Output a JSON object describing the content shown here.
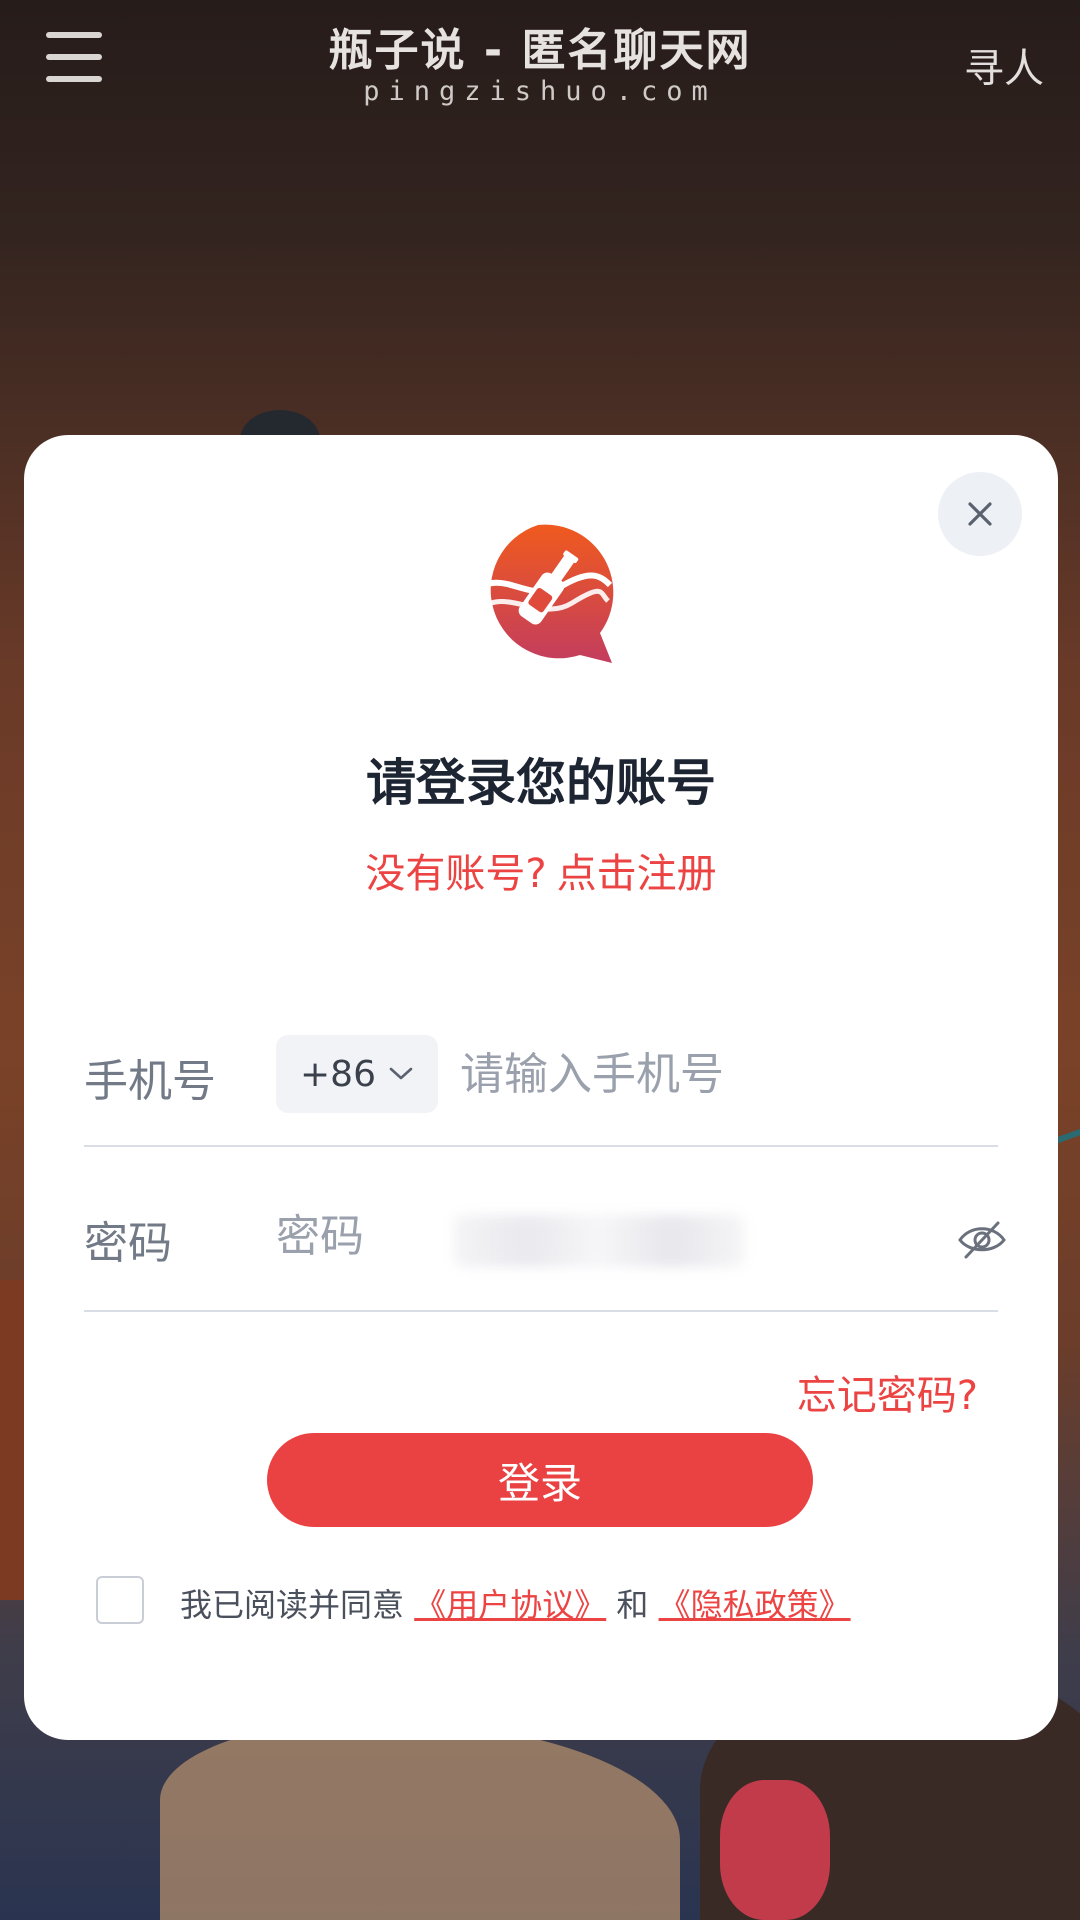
{
  "header": {
    "title": "瓶子说 - 匿名聊天网",
    "domain": "pingzishuo.com",
    "find_people": "寻人"
  },
  "modal": {
    "title": "请登录您的账号",
    "register_question": "没有账号?",
    "register_link": "点击注册",
    "phone": {
      "label": "手机号",
      "country_code": "+86",
      "placeholder": "请输入手机号"
    },
    "password": {
      "label": "密码",
      "placeholder": "密码"
    },
    "forgot_password": "忘记密码?",
    "login_button": "登录",
    "agreement": {
      "prefix": "我已阅读并同意",
      "user_agreement": "《用户协议》",
      "and": "和",
      "privacy_policy": "《隐私政策》",
      "checked": false
    }
  },
  "colors": {
    "accent": "#ea4143",
    "link": "#ec4343",
    "title": "#1d2533",
    "logo_top": "#f05a1e",
    "logo_bottom": "#c33d5e"
  },
  "icons": {
    "menu": "hamburger-menu-icon",
    "close": "close-icon",
    "chevron": "chevron-down-icon",
    "password_visibility": "eye-off-icon",
    "logo": "bottle-chat-logo"
  }
}
